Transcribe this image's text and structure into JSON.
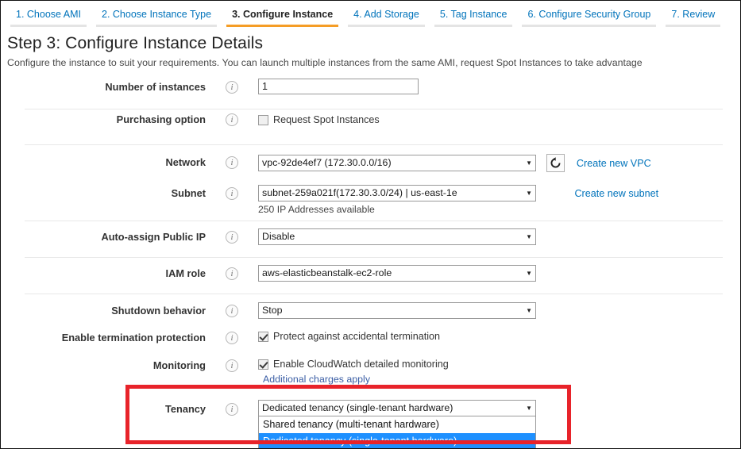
{
  "wizard": {
    "tabs": [
      {
        "label": "1. Choose AMI",
        "active": false
      },
      {
        "label": "2. Choose Instance Type",
        "active": false
      },
      {
        "label": "3. Configure Instance",
        "active": true
      },
      {
        "label": "4. Add Storage",
        "active": false
      },
      {
        "label": "5. Tag Instance",
        "active": false
      },
      {
        "label": "6. Configure Security Group",
        "active": false
      },
      {
        "label": "7. Review",
        "active": false
      }
    ]
  },
  "page": {
    "title": "Step 3: Configure Instance Details",
    "description": "Configure the instance to suit your requirements. You can launch multiple instances from the same AMI, request Spot Instances to take advantage"
  },
  "form": {
    "number_of_instances": {
      "label": "Number of instances",
      "value": "1",
      "info": "i"
    },
    "purchasing_option": {
      "label": "Purchasing option",
      "checkbox_label": "Request Spot Instances",
      "checked": false
    },
    "network": {
      "label": "Network",
      "value": "vpc-92de4ef7 (172.30.0.0/16)",
      "refresh_icon": "refresh-icon",
      "link": "Create new VPC"
    },
    "subnet": {
      "label": "Subnet",
      "value": "subnet-259a021f(172.30.3.0/24) | us-east-1e",
      "hint": "250 IP Addresses available",
      "link": "Create new subnet"
    },
    "auto_assign_public_ip": {
      "label": "Auto-assign Public IP",
      "value": "Disable"
    },
    "iam_role": {
      "label": "IAM role",
      "value": "aws-elasticbeanstalk-ec2-role"
    },
    "shutdown_behavior": {
      "label": "Shutdown behavior",
      "value": "Stop"
    },
    "termination_protection": {
      "label": "Enable termination protection",
      "checkbox_label": "Protect against accidental termination",
      "checked": true
    },
    "monitoring": {
      "label": "Monitoring",
      "checkbox_label": "Enable CloudWatch detailed monitoring",
      "checked": true,
      "charges_link": "Additional charges apply"
    },
    "tenancy": {
      "label": "Tenancy",
      "value": "Dedicated tenancy (single-tenant hardware)",
      "options": [
        "Shared tenancy (multi-tenant hardware)",
        "Dedicated tenancy (single-tenant hardware)"
      ],
      "selected_index": 1
    }
  },
  "colors": {
    "link": "#0073bb",
    "active_tab_underline": "#f59d26",
    "highlight_box": "#e8232a",
    "option_selected_bg": "#1e90ff"
  }
}
